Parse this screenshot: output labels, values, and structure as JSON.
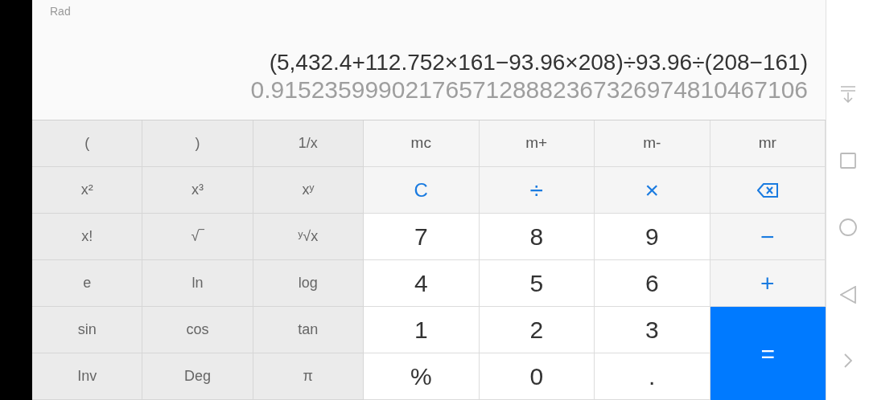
{
  "display": {
    "angle_mode": "Rad",
    "expression": "(5,432.4+112.752×161−93.96×208)÷93.96÷(208−161)",
    "result": "0.9152359990217657128882367326974810467106"
  },
  "scientific_keys": [
    {
      "label": "("
    },
    {
      "label": ")"
    },
    {
      "label": "1/x"
    },
    {
      "label": "x²"
    },
    {
      "label": "x³"
    },
    {
      "label": "xʸ"
    },
    {
      "label": "x!"
    },
    {
      "label": "√‾"
    },
    {
      "label": "ʸ√x"
    },
    {
      "label": "e"
    },
    {
      "label": "ln"
    },
    {
      "label": "log"
    },
    {
      "label": "sin"
    },
    {
      "label": "cos"
    },
    {
      "label": "tan"
    },
    {
      "label": "Inv"
    },
    {
      "label": "Deg"
    },
    {
      "label": "π"
    }
  ],
  "keys": [
    {
      "kind": "memory",
      "label": "mc"
    },
    {
      "kind": "memory",
      "label": "m+"
    },
    {
      "kind": "memory",
      "label": "m-"
    },
    {
      "kind": "memory",
      "label": "mr"
    },
    {
      "kind": "clear",
      "label": "C"
    },
    {
      "kind": "operator",
      "label": "÷"
    },
    {
      "kind": "operator",
      "label": "×"
    },
    {
      "kind": "backspace"
    },
    {
      "kind": "digit",
      "label": "7"
    },
    {
      "kind": "digit",
      "label": "8"
    },
    {
      "kind": "digit",
      "label": "9"
    },
    {
      "kind": "operator",
      "label": "−"
    },
    {
      "kind": "digit",
      "label": "4"
    },
    {
      "kind": "digit",
      "label": "5"
    },
    {
      "kind": "digit",
      "label": "6"
    },
    {
      "kind": "operator",
      "label": "+"
    },
    {
      "kind": "digit",
      "label": "1"
    },
    {
      "kind": "digit",
      "label": "2"
    },
    {
      "kind": "digit",
      "label": "3"
    },
    {
      "kind": "equals",
      "label": "="
    },
    {
      "kind": "digit",
      "label": "%"
    },
    {
      "kind": "digit",
      "label": "0"
    },
    {
      "kind": "digit",
      "label": "."
    }
  ]
}
